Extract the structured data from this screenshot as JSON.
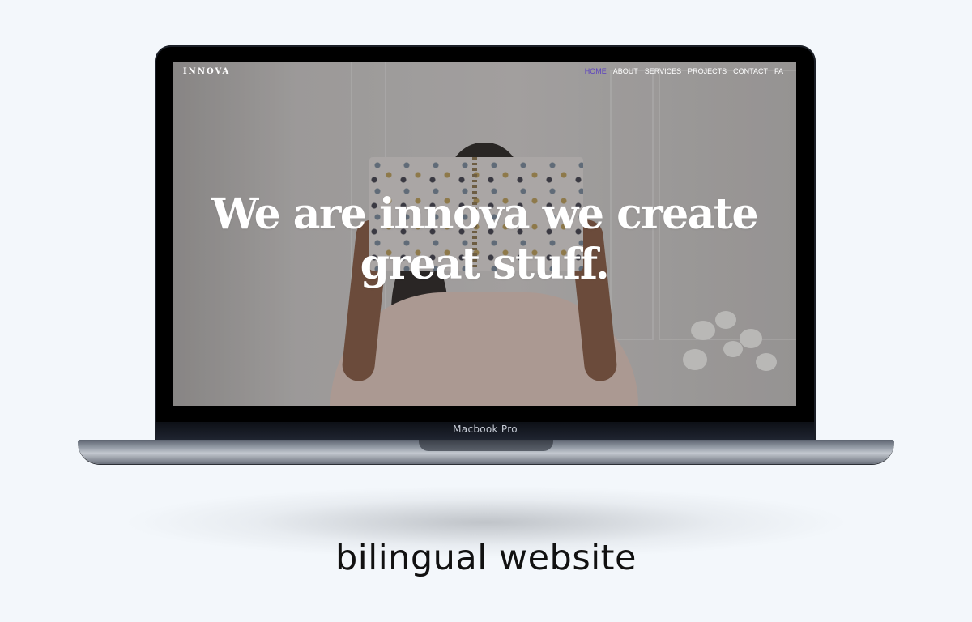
{
  "device": {
    "label": "Macbook Pro"
  },
  "site": {
    "logo": "INNOVA",
    "nav": [
      {
        "label": "HOME",
        "active": true
      },
      {
        "label": "ABOUT",
        "active": false
      },
      {
        "label": "SERVICES",
        "active": false
      },
      {
        "label": "PROJECTS",
        "active": false
      },
      {
        "label": "CONTACT",
        "active": false
      },
      {
        "label": "FA",
        "active": false
      }
    ],
    "hero": {
      "line1": "We are innova we create",
      "line2": "great stuff."
    },
    "colors": {
      "nav_active": "#5a3fc0",
      "nav_default": "#ffffff",
      "hero_text": "#ffffff"
    }
  },
  "caption": "bilingual website"
}
